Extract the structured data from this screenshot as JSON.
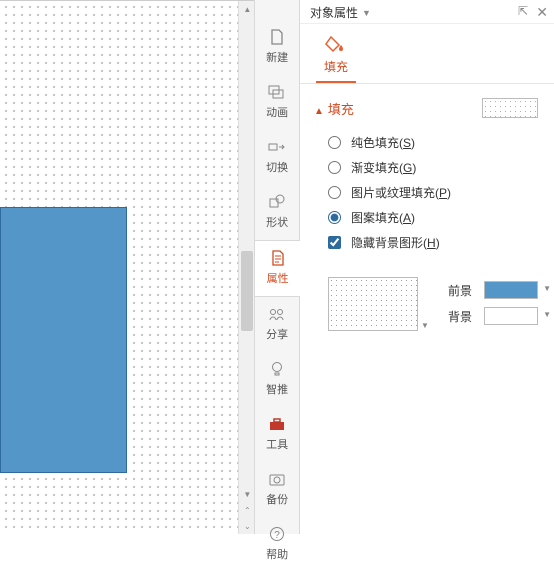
{
  "canvas": {
    "shape_color": "#5596c9"
  },
  "vtabs": {
    "new": "新建",
    "anim": "动画",
    "trans": "切换",
    "shape": "形状",
    "prop": "属性",
    "share": "分享",
    "smart": "智推",
    "tool": "工具",
    "backup": "备份",
    "help": "帮助"
  },
  "panel": {
    "title": "对象属性",
    "subtab_fill": "填充",
    "section_fill": "填充",
    "options": {
      "solid": "纯色填充",
      "solid_k": "S",
      "grad": "渐变填充",
      "grad_k": "G",
      "pic": "图片或纹理填充",
      "pic_k": "P",
      "pattern": "图案填充",
      "pattern_k": "A",
      "hide": "隐藏背景图形",
      "hide_k": "H"
    },
    "fg_label": "前景",
    "bg_label": "背景"
  }
}
